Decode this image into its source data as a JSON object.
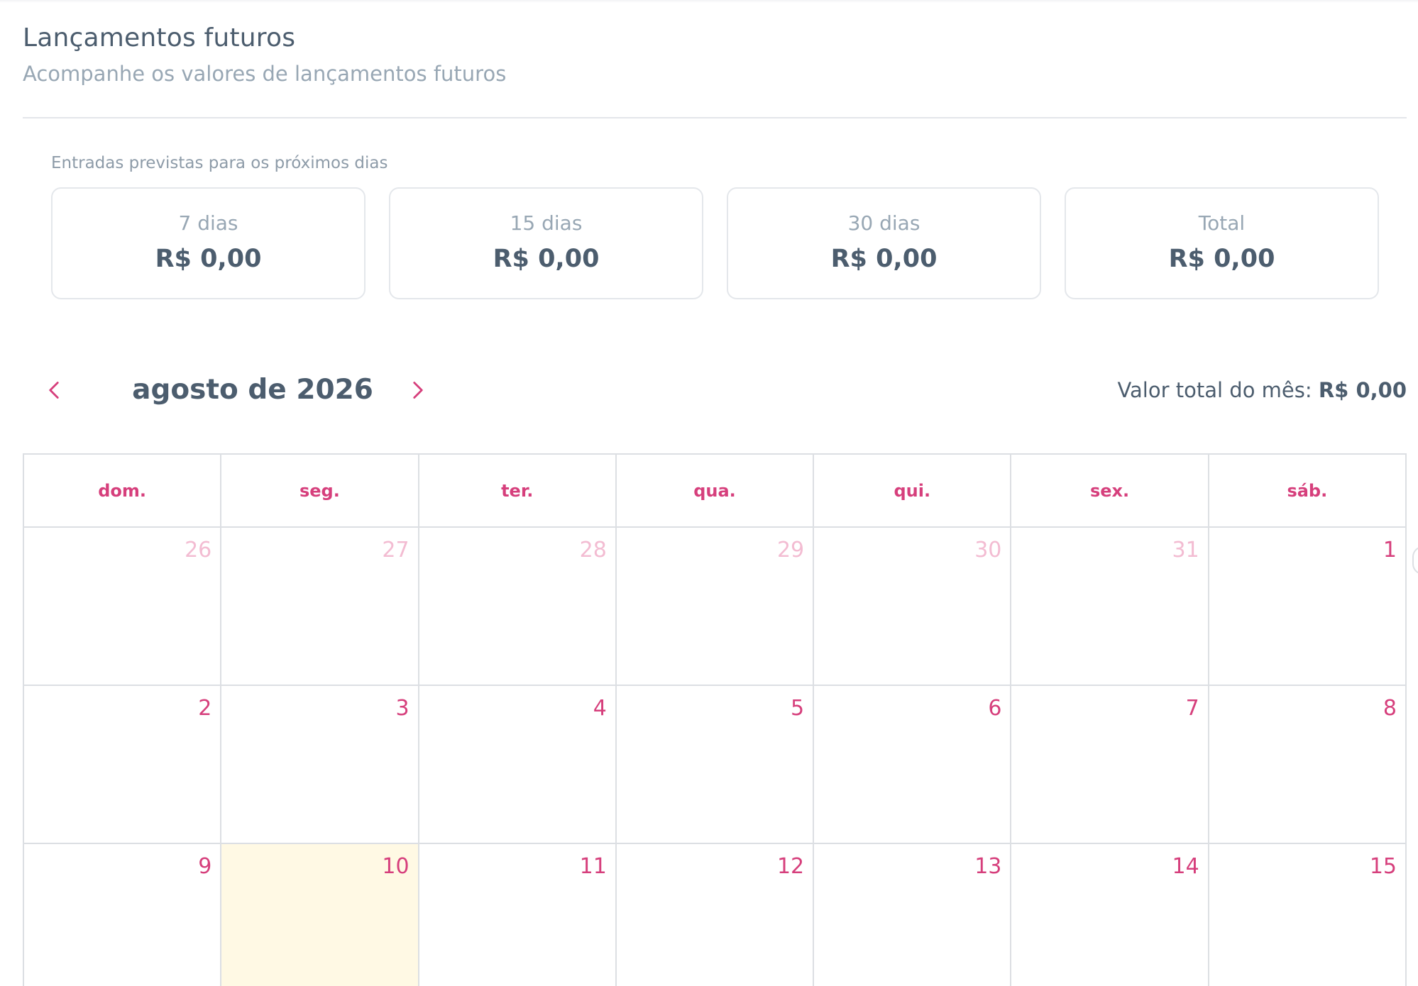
{
  "header": {
    "title": "Lançamentos futuros",
    "subtitle": "Acompanhe os valores de lançamentos futuros"
  },
  "forecast": {
    "label": "Entradas previstas para os próximos dias",
    "cards": [
      {
        "label": "7 dias",
        "value": "R$ 0,00"
      },
      {
        "label": "15 dias",
        "value": "R$ 0,00"
      },
      {
        "label": "30 dias",
        "value": "R$ 0,00"
      },
      {
        "label": "Total",
        "value": "R$ 0,00"
      }
    ]
  },
  "calendar": {
    "month_title": "agosto de 2026",
    "total_label": "Valor total do mês:",
    "total_value": "R$ 0,00",
    "weekdays": [
      "dom.",
      "seg.",
      "ter.",
      "qua.",
      "qui.",
      "sex.",
      "sáb."
    ],
    "weeks": [
      [
        "26",
        "27",
        "28",
        "29",
        "30",
        "31",
        "1"
      ],
      [
        "2",
        "3",
        "4",
        "5",
        "6",
        "7",
        "8"
      ],
      [
        "9",
        "10",
        "11",
        "12",
        "13",
        "14",
        "15"
      ]
    ]
  },
  "colors": {
    "accent": "#d63f7c",
    "accent_muted": "#f3bcd2",
    "text_dark": "#4c5d6e",
    "text_muted": "#98a7b4",
    "today_background": "#fff9e4",
    "border": "#dcdfe3"
  },
  "icons": {
    "prev": "chevron-left-icon",
    "next": "chevron-right-icon"
  }
}
